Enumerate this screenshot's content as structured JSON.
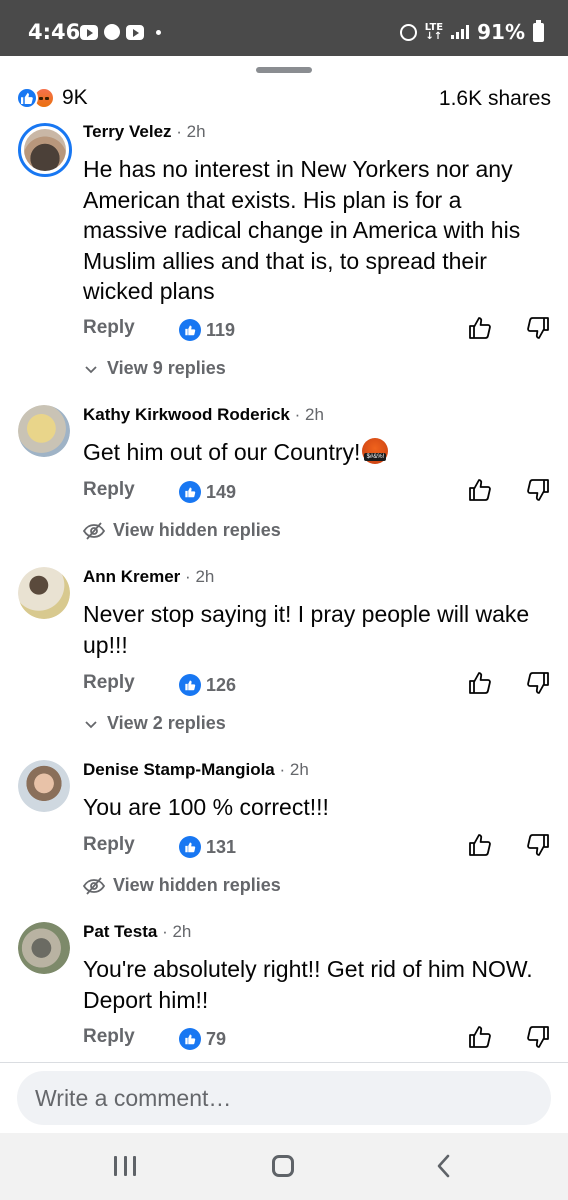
{
  "status_bar": {
    "time": "4:46",
    "network": "LTE",
    "battery": "91%"
  },
  "post_stats": {
    "reaction_count": "9K",
    "shares": "1.6K shares"
  },
  "comments": [
    {
      "name": "Terry Velez",
      "time": "2h",
      "text": "He has no interest in New Yorkers nor any American that exists. His plan is for a massive radical change in America with his Muslim allies and that is, to spread their wicked plans",
      "reply_label": "Reply",
      "likes": "119",
      "more": "View 9 replies"
    },
    {
      "name": "Kathy Kirkwood Roderick",
      "time": "2h",
      "text": "Get him out of our Country!",
      "reply_label": "Reply",
      "likes": "149",
      "more": "View hidden replies"
    },
    {
      "name": "Ann Kremer",
      "time": "2h",
      "text": "Never stop saying it! I pray people will wake up!!!",
      "reply_label": "Reply",
      "likes": "126",
      "more": "View 2 replies"
    },
    {
      "name": "Denise Stamp-Mangiola",
      "time": "2h",
      "text": "You are 100 % correct!!!",
      "reply_label": "Reply",
      "likes": "131",
      "more": "View hidden replies"
    },
    {
      "name": "Pat Testa",
      "time": "2h",
      "text": "You're absolutely right!!  Get rid of him NOW.  Deport him!!",
      "reply_label": "Reply",
      "likes": "79"
    }
  ],
  "composer": {
    "placeholder": "Write a comment…"
  },
  "colors": {
    "accent": "#1877f2",
    "secondary_text": "#65676b",
    "status_bar": "#4a4a4a"
  },
  "icons": [
    "like-reaction-icon",
    "angry-reaction-icon",
    "thumbs-up-icon",
    "thumbs-down-icon",
    "chevron-down-icon",
    "eye-slash-icon",
    "recent-apps-icon",
    "home-icon",
    "back-icon"
  ]
}
